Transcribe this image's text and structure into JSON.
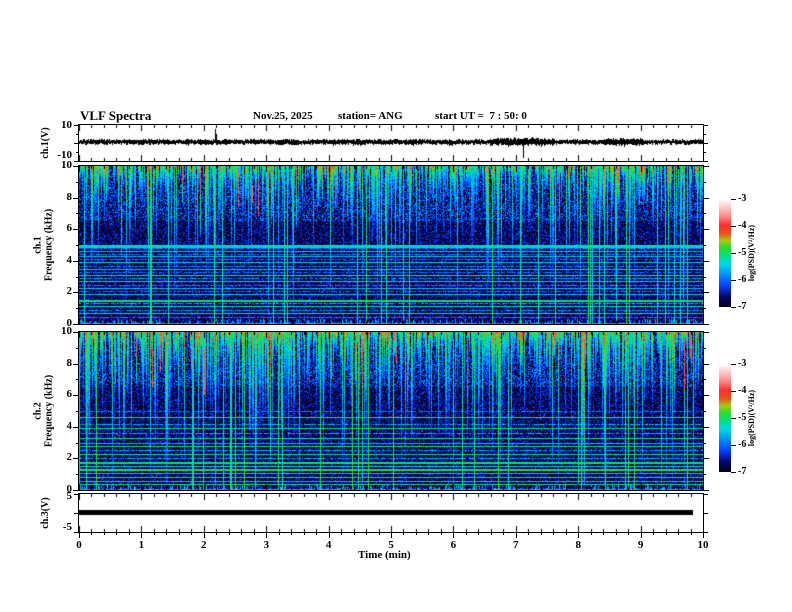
{
  "header": {
    "title": "VLF Spectra",
    "date": "Nov.25, 2025",
    "station": "station= ANG",
    "start_ut": "start UT =  7 : 50: 0"
  },
  "time_axis": {
    "label": "Time (min)",
    "min": 0,
    "max": 10,
    "tick_labels": [
      "0",
      "1",
      "2",
      "3",
      "4",
      "5",
      "6",
      "7",
      "8",
      "9",
      "10"
    ]
  },
  "freq_axis": {
    "label_line2": "Frequency (kHz)",
    "min": 0,
    "max": 10,
    "tick_labels_top_to_bottom": [
      "10",
      "8",
      "6",
      "4",
      "2",
      "0"
    ]
  },
  "panels": {
    "ch1_wave": {
      "axis_label": "ch.1(V)",
      "ymax_label": "10",
      "ymin_label": "-10",
      "ylim": [
        -10,
        10
      ]
    },
    "ch1_spec": {
      "label_line1": "ch.1"
    },
    "ch2_spec": {
      "label_line1": "ch.2"
    },
    "ch3_wave": {
      "axis_label": "ch.3(V)",
      "ymax_label": "5",
      "ymin_label": "-5",
      "ylim": [
        -5,
        5
      ]
    }
  },
  "colorbar": {
    "label": "log(PSD)(V²/Hz)",
    "tick_labels_top_to_bottom": [
      "-3",
      "-4",
      "-5",
      "-6",
      "-7"
    ],
    "range": [
      -7,
      -3
    ],
    "colormap_stops": [
      [
        0.0,
        2,
        2,
        18
      ],
      [
        0.1,
        6,
        6,
        110
      ],
      [
        0.2,
        10,
        60,
        255
      ],
      [
        0.3,
        0,
        140,
        255
      ],
      [
        0.4,
        0,
        215,
        235
      ],
      [
        0.48,
        0,
        225,
        130
      ],
      [
        0.55,
        40,
        220,
        50
      ],
      [
        0.62,
        170,
        200,
        20
      ],
      [
        0.68,
        230,
        90,
        25
      ],
      [
        0.76,
        255,
        45,
        45
      ],
      [
        0.86,
        255,
        150,
        150
      ],
      [
        1.0,
        255,
        255,
        255
      ]
    ]
  },
  "colors": {
    "background": "#ffffff",
    "ink": "#000000"
  },
  "chart_data": [
    {
      "type": "line",
      "panel": "ch.1(V) waveform",
      "xlim": [
        0,
        10
      ],
      "ylim": [
        -10,
        10
      ],
      "description": "Broadband noise centered at 0 V, about ±1 V, upward spike near t=2.2 min, downward spike near t=7.1 min, slightly thicker noise 6.6-7.6 min and 8.4-9.0 min."
    },
    {
      "type": "heatmap",
      "panel": "ch.1 spectrogram",
      "xlim": [
        0,
        10
      ],
      "ylim": [
        0,
        10
      ],
      "ylabel": "Frequency (kHz)",
      "colorbar_range": [
        -7,
        -3
      ],
      "tone_lines_khz": [
        {
          "f": 5.0,
          "v": -5.35,
          "th": 3
        },
        {
          "f": 4.8,
          "v": -5.9,
          "th": 1
        },
        {
          "f": 4.6,
          "v": -5.5,
          "th": 1
        },
        {
          "f": 4.45,
          "v": -5.8,
          "th": 1
        },
        {
          "f": 4.3,
          "v": -5.5,
          "th": 1
        },
        {
          "f": 4.1,
          "v": -5.9,
          "th": 1
        },
        {
          "f": 3.9,
          "v": -5.4,
          "th": 1
        },
        {
          "f": 3.7,
          "v": -5.8,
          "th": 1
        },
        {
          "f": 3.5,
          "v": -5.5,
          "th": 1
        },
        {
          "f": 3.3,
          "v": -5.9,
          "th": 1
        },
        {
          "f": 3.1,
          "v": -5.3,
          "th": 1
        },
        {
          "f": 2.9,
          "v": -5.7,
          "th": 1
        },
        {
          "f": 2.7,
          "v": -5.4,
          "th": 1
        },
        {
          "f": 2.5,
          "v": -5.8,
          "th": 1
        },
        {
          "f": 2.3,
          "v": -5.5,
          "th": 1
        },
        {
          "f": 2.1,
          "v": -5.9,
          "th": 1
        },
        {
          "f": 1.9,
          "v": -5.5,
          "th": 1
        },
        {
          "f": 1.55,
          "v": -5.0,
          "th": 2
        },
        {
          "f": 1.3,
          "v": -5.6,
          "th": 1
        },
        {
          "f": 1.15,
          "v": -5.2,
          "th": 1
        },
        {
          "f": 0.9,
          "v": -5.7,
          "th": 1
        },
        {
          "f": 0.7,
          "v": -5.3,
          "th": 1
        },
        {
          "f": 0.45,
          "v": -5.8,
          "th": 1
        }
      ],
      "description": "Dense vertical sferic streaks from 10 kHz down to ~5 kHz (cyan/green, occasional red), bright cyan band at 5 kHz, many thin horizontal tone lines below 5 kHz over dark background, thin vertical green lines spanning all frequencies."
    },
    {
      "type": "heatmap",
      "panel": "ch.2 spectrogram",
      "xlim": [
        0,
        10
      ],
      "ylim": [
        0,
        10
      ],
      "ylabel": "Frequency (kHz)",
      "colorbar_range": [
        -7,
        -3
      ],
      "tone_lines_khz": [
        {
          "f": 5.0,
          "v": -5.9,
          "th": 1
        },
        {
          "f": 4.6,
          "v": -5.2,
          "th": 1
        },
        {
          "f": 4.2,
          "v": -5.6,
          "th": 1
        },
        {
          "f": 3.9,
          "v": -5.1,
          "th": 1
        },
        {
          "f": 3.6,
          "v": -5.6,
          "th": 1
        },
        {
          "f": 3.3,
          "v": -5.1,
          "th": 1
        },
        {
          "f": 3.0,
          "v": -5.5,
          "th": 1
        },
        {
          "f": 2.8,
          "v": -5.0,
          "th": 1
        },
        {
          "f": 2.55,
          "v": -5.6,
          "th": 1
        },
        {
          "f": 2.3,
          "v": -5.1,
          "th": 1
        },
        {
          "f": 2.05,
          "v": -5.6,
          "th": 1
        },
        {
          "f": 1.8,
          "v": -5.0,
          "th": 2
        },
        {
          "f": 1.55,
          "v": -5.4,
          "th": 1
        },
        {
          "f": 1.3,
          "v": -4.9,
          "th": 2
        },
        {
          "f": 1.1,
          "v": -5.5,
          "th": 1
        },
        {
          "f": 0.85,
          "v": -5.1,
          "th": 1
        },
        {
          "f": 0.6,
          "v": -5.5,
          "th": 1
        },
        {
          "f": 0.35,
          "v": -5.0,
          "th": 1
        }
      ],
      "description": "Similar to ch.1 but with longer/greener streaks from the top, more bright green horizontal lines below 4 kHz, weaker 5 kHz band."
    },
    {
      "type": "line",
      "panel": "ch.3(V) waveform",
      "xlim": [
        0,
        10
      ],
      "ylim": [
        -5,
        5
      ],
      "description": "Flat thick line at 0 V spanning 0 to ~9.85 min."
    }
  ]
}
